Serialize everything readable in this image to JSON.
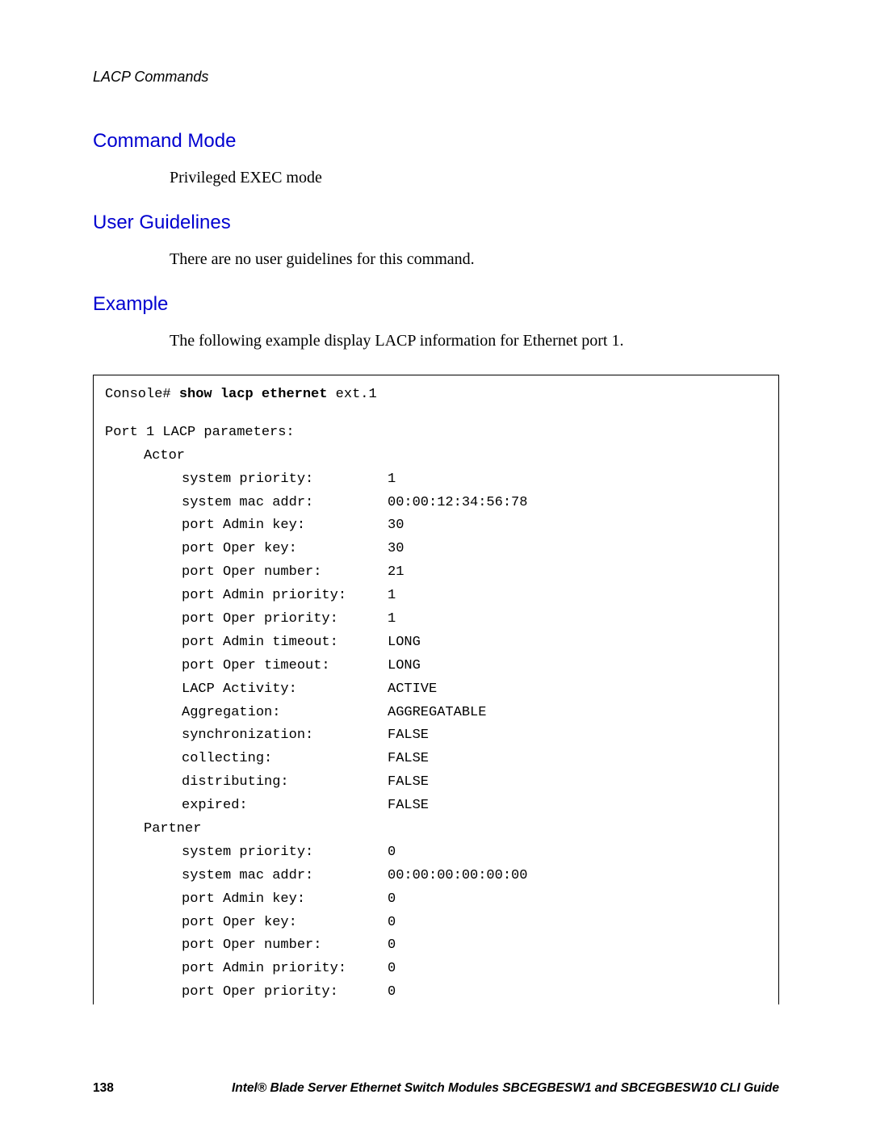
{
  "running_head": "LACP Commands",
  "sections": {
    "command_mode": {
      "heading": "Command Mode",
      "body": "Privileged EXEC mode"
    },
    "user_guidelines": {
      "heading": "User Guidelines",
      "body": "There are no user guidelines for this command."
    },
    "example": {
      "heading": "Example",
      "body": "The following example display LACP information for Ethernet port 1."
    }
  },
  "code": {
    "prompt": "Console#",
    "cmd_bold": "show lacp ethernet",
    "cmd_arg": "ext.1",
    "header": "Port 1 LACP parameters:",
    "actor_label": "Actor",
    "partner_label": "Partner",
    "actor_rows": [
      {
        "label": "system priority:",
        "value": "1"
      },
      {
        "label": "system mac addr:",
        "value": "00:00:12:34:56:78"
      },
      {
        "label": "port Admin key:",
        "value": "30"
      },
      {
        "label": "port Oper key:",
        "value": "30"
      },
      {
        "label": "port Oper number:",
        "value": "21"
      },
      {
        "label": "port Admin priority:",
        "value": "1"
      },
      {
        "label": "port Oper priority:",
        "value": "1"
      },
      {
        "label": "port Admin timeout:",
        "value": "LONG"
      },
      {
        "label": "port Oper timeout:",
        "value": "LONG"
      },
      {
        "label": "LACP Activity:",
        "value": "ACTIVE"
      },
      {
        "label": "Aggregation:",
        "value": "AGGREGATABLE"
      },
      {
        "label": "synchronization:",
        "value": "FALSE"
      },
      {
        "label": "collecting:",
        "value": "FALSE"
      },
      {
        "label": "distributing:",
        "value": "FALSE"
      },
      {
        "label": "expired:",
        "value": "FALSE"
      }
    ],
    "partner_rows": [
      {
        "label": "system priority:",
        "value": "0"
      },
      {
        "label": "system mac addr:",
        "value": "00:00:00:00:00:00"
      },
      {
        "label": "port Admin key:",
        "value": "0"
      },
      {
        "label": "port Oper key:",
        "value": "0"
      },
      {
        "label": "port Oper number:",
        "value": "0"
      },
      {
        "label": "port Admin priority:",
        "value": "0"
      },
      {
        "label": "port Oper priority:",
        "value": "0"
      }
    ]
  },
  "footer": {
    "page_number": "138",
    "text": "Intel® Blade Server Ethernet Switch Modules SBCEGBESW1 and SBCEGBESW10 CLI Guide"
  }
}
